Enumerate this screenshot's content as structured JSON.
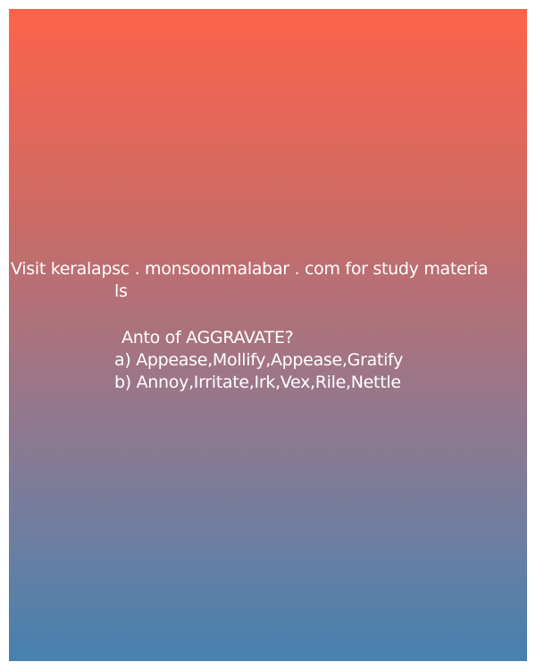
{
  "promo": {
    "line1": "Visit keralapsc . monsoonmalabar . com for study materia",
    "line2": "ls"
  },
  "question": {
    "text": "Anto of AGGRAVATE?"
  },
  "options": {
    "a": "a) Appease,Mollify,Appease,Gratify",
    "b": "b) Annoy,Irritate,Irk,Vex,Rile,Nettle"
  },
  "colors": {
    "gradient_top": "#fe634b",
    "gradient_bottom": "#4681b0",
    "text": "#ffffff"
  }
}
